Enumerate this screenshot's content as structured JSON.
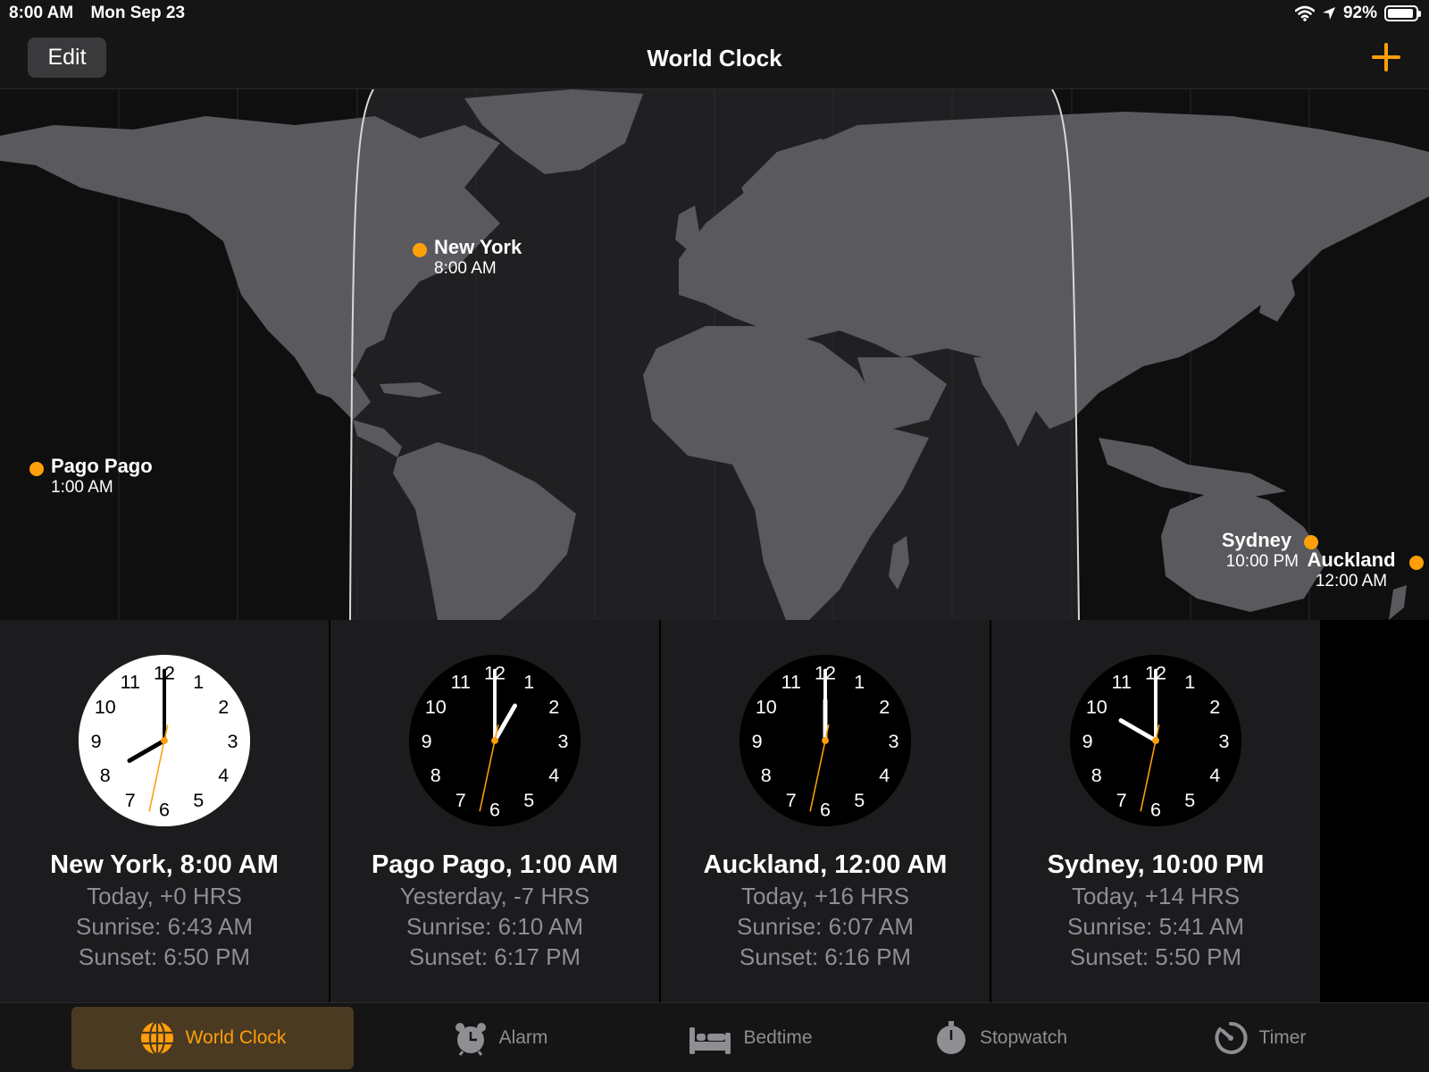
{
  "status_bar": {
    "time": "8:00 AM",
    "date": "Mon Sep 23",
    "battery": "92%",
    "battery_level": 0.92
  },
  "nav": {
    "edit_label": "Edit",
    "title": "World Clock"
  },
  "map_cities": [
    {
      "name": "New York",
      "time": "8:00 AM"
    },
    {
      "name": "Pago Pago",
      "time": "1:00 AM"
    },
    {
      "name": "Sydney",
      "time": "10:00 PM"
    },
    {
      "name": "Auckland",
      "time": "12:00 AM"
    }
  ],
  "clocks": [
    {
      "title": "New York, 8:00 AM",
      "day": "Today, +0 HRS",
      "sunrise": "Sunrise: 6:43 AM",
      "sunset": "Sunset: 6:50 PM",
      "hour": 8,
      "minute": 0,
      "second": 32,
      "daytime": true
    },
    {
      "title": "Pago Pago, 1:00 AM",
      "day": "Yesterday, -7 HRS",
      "sunrise": "Sunrise: 6:10 AM",
      "sunset": "Sunset: 6:17 PM",
      "hour": 1,
      "minute": 0,
      "second": 32,
      "daytime": false
    },
    {
      "title": "Auckland, 12:00 AM",
      "day": "Today, +16 HRS",
      "sunrise": "Sunrise: 6:07 AM",
      "sunset": "Sunset: 6:16 PM",
      "hour": 12,
      "minute": 0,
      "second": 32,
      "daytime": false
    },
    {
      "title": "Sydney, 10:00 PM",
      "day": "Today, +14 HRS",
      "sunrise": "Sunrise: 5:41 AM",
      "sunset": "Sunset: 5:50 PM",
      "hour": 10,
      "minute": 0,
      "second": 32,
      "daytime": false
    }
  ],
  "tabs": [
    {
      "label": "World Clock",
      "icon": "globe-icon",
      "active": true
    },
    {
      "label": "Alarm",
      "icon": "alarm-clock-icon",
      "active": false
    },
    {
      "label": "Bedtime",
      "icon": "bed-icon",
      "active": false
    },
    {
      "label": "Stopwatch",
      "icon": "stopwatch-icon",
      "active": false
    },
    {
      "label": "Timer",
      "icon": "timer-icon",
      "active": false
    }
  ],
  "colors": {
    "accent": "#ff9f0a",
    "land": "#5a5a5e",
    "night": "#0f0f0f",
    "card": "#1c1c1e",
    "muted": "#8e8e93"
  }
}
